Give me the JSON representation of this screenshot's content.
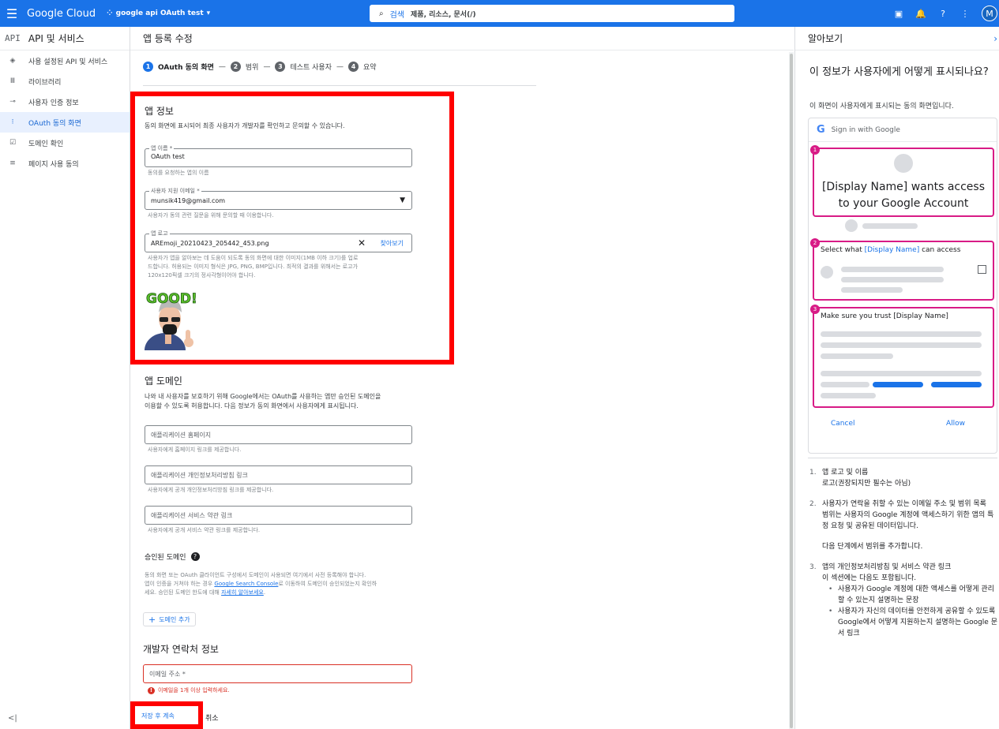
{
  "topbar": {
    "brand": "Google Cloud",
    "project": "google api OAuth test",
    "search_label": "검색",
    "search_placeholder": "제품, 리소스, 문서(/)",
    "avatar": "M"
  },
  "leftnav": {
    "title_code": "API",
    "title": "API 및 서비스",
    "items": [
      {
        "label": "사용 설정된 API 및 서비스",
        "icon": "diamond-icon"
      },
      {
        "label": "라이브러리",
        "icon": "library-icon"
      },
      {
        "label": "사용자 인증 정보",
        "icon": "key-icon"
      },
      {
        "label": "OAuth 동의 화면",
        "icon": "consent-icon"
      },
      {
        "label": "도메인 확인",
        "icon": "checkbox-icon"
      },
      {
        "label": "페이지 사용 동의",
        "icon": "settings-list-icon"
      }
    ],
    "collapse": "<|"
  },
  "main": {
    "title": "앱 등록 수정",
    "steps": [
      {
        "num": "1",
        "label": "OAuth 동의 화면"
      },
      {
        "num": "2",
        "label": "범위"
      },
      {
        "num": "3",
        "label": "테스트 사용자"
      },
      {
        "num": "4",
        "label": "요약"
      }
    ],
    "app_info": {
      "title": "앱 정보",
      "desc": "동의 화면에 표시되어 최종 사용자가 개발자를 확인하고 문의할 수 있습니다.",
      "app_name_label": "앱 이름 *",
      "app_name_value": "OAuth test",
      "app_name_hint": "동의를 요청하는 앱의 이름",
      "email_label": "사용자 지원 이메일 *",
      "email_value": "munsik419@gmail.com",
      "email_hint": "사용자가 동의 관련 질문을 위해 문의할 때 이용합니다.",
      "logo_label": "앱 로고",
      "logo_value": "AREmoji_20210423_205442_453.png",
      "logo_browse": "찾아보기",
      "logo_hint_1": "사용자가 앱을 알아보는 데 도움이 되도록 동의 화면에 대한 이미지(1MB 이하 크기)를 업로",
      "logo_hint_2": "드합니다. 허용되는 이미지 형식은 JPG, PNG, BMP입니다. 최적의 결과를 위해서는 로고가",
      "logo_hint_3": "120x120픽셀 크기의 정사각형이어야 합니다.",
      "logo_image_text": "GOOD!"
    },
    "app_domain": {
      "title": "앱 도메인",
      "desc_1": "나와 내 사용자를 보호하기 위해 Google에서는 OAuth를 사용하는 앱만 승인된 도메인을",
      "desc_2": "이용할 수 있도록 허용합니다. 다음 정보가 동의 화면에서 사용자에게 표시됩니다.",
      "homepage_placeholder": "애플리케이션 홈페이지",
      "homepage_hint": "사용자에게 홈페이지 링크를 제공합니다.",
      "privacy_placeholder": "애플리케이션 개인정보처리방침 링크",
      "privacy_hint": "사용자에게 공개 개인정보처리방침 링크를 제공합니다.",
      "tos_placeholder": "애플리케이션 서비스 약관 링크",
      "tos_hint": "사용자에게 공개 서비스 약관 링크를 제공합니다."
    },
    "authorized": {
      "title": "승인된 도메인",
      "desc_1": "동의 화면 또는 OAuth 클라이언트 구성에서 도메인이 사용되면 여기에서 사전 등록해야 합니다.",
      "desc_2a": "앱이 인증을 거쳐야 하는 경우 ",
      "desc_2_link": "Google Search Console",
      "desc_2b": "로 이동하여 도메인이 승인되었는지 확인하",
      "desc_3a": "세요. 승인된 도메인 한도에 대해 ",
      "desc_3_link": "자세히 알아보세요",
      "desc_3b": ".",
      "add_button": "도메인 추가"
    },
    "developer": {
      "title": "개발자 연락처 정보",
      "email_placeholder": "이메일 주소 *",
      "error": "이메일을 1개 이상 입력하세요."
    },
    "save_button": "저장 후 계속",
    "cancel_button": "취소"
  },
  "rightpanel": {
    "title": "알아보기",
    "heading": "이 정보가 사용자에게 어떻게 표시되나요?",
    "sub": "이 화면이 사용자에게 표시되는 동의 화면입니다.",
    "mock": {
      "signin": "Sign in with Google",
      "card1_text": "[Display Name] wants access to your Google Account",
      "card2_a": "Select what ",
      "card2_b": "[Display Name]",
      "card2_c": " can access",
      "card3_text": "Make sure you trust [Display Name]",
      "cancel": "Cancel",
      "allow": "Allow",
      "badges": [
        "1",
        "2",
        "3"
      ]
    },
    "list": [
      {
        "num": "1.",
        "title": "앱 로고 및 이름",
        "text": "로고(권장되지만 필수는 아님)"
      },
      {
        "num": "2.",
        "title": "사용자가 연락을 취할 수 있는 이메일 주소 및 범위 목록",
        "text": "범위는 사용자의 Google 계정에 액세스하기 위한 앱의 특정 요청 및 공유된 데이터입니다.",
        "text2": "다음 단계에서 범위를 추가합니다."
      },
      {
        "num": "3.",
        "title": "앱의 개인정보처리방침 및 서비스 약관 링크",
        "text": "이 섹션에는 다음도 포함됩니다.",
        "bullets": [
          "사용자가 Google 계정에 대한 액세스를 어떻게 관리할 수 있는지 설명하는 문장",
          "사용자가 자신의 데이터를 안전하게 공유할 수 있도록 Google에서 어떻게 지원하는지 설명하는 Google 문서 링크"
        ]
      }
    ]
  },
  "colors": {
    "accent": "#1a73e8",
    "highlight_box": "#ff0000",
    "mock_border": "#d81b86",
    "error": "#d93025"
  }
}
